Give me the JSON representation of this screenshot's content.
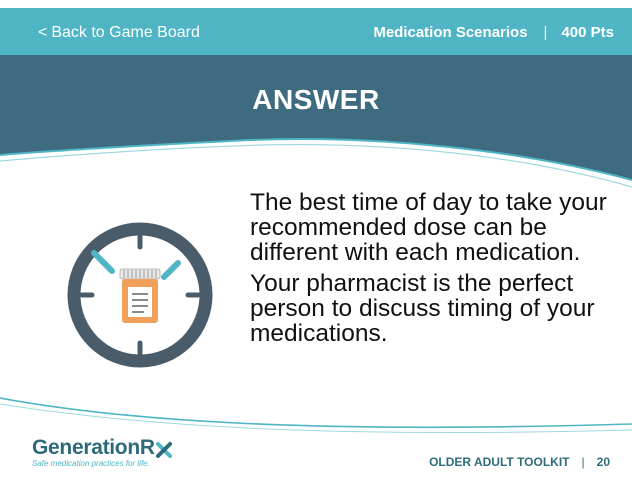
{
  "topbar": {
    "back_label": "Back to Game Board",
    "back_chevron": "<",
    "category": "Medication Scenarios",
    "separator": "|",
    "points": "400 Pts"
  },
  "banner": {
    "title": "ANSWER"
  },
  "content": {
    "paragraphs": [
      "The best time of day to take your recommended dose can be different with each medication.",
      "Your pharmacist is the perfect person to discuss timing of your medications."
    ],
    "illustration": "clock-with-pill-bottle-icon"
  },
  "footer": {
    "brand_name": "GenerationR",
    "brand_tagline": "Safe medication practices for life.",
    "toolkit_label": "OLDER ADULT TOOLKIT",
    "separator": "|",
    "page_number": "20"
  },
  "colors": {
    "teal": "#4fb5c4",
    "dark_blue": "#3e6b80",
    "clock_ring": "#4a5b6a",
    "bottle_orange": "#f0a05a"
  }
}
